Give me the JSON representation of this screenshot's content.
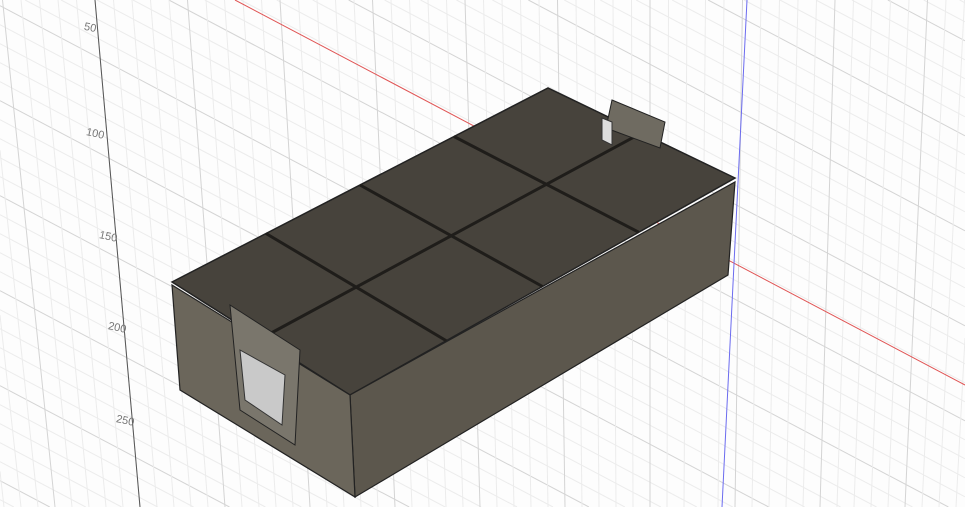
{
  "viewport": {
    "ruler_ticks": [
      "50",
      "100",
      "150",
      "200",
      "250"
    ],
    "colors": {
      "x_axis": "#e05555",
      "z_axis": "#6b6bef",
      "body": "#5c574d",
      "interior": "#47433c",
      "edge": "#2a2824"
    }
  },
  "model": {
    "name": "storage-bin",
    "cells_long": 4,
    "cells_short": 2
  }
}
